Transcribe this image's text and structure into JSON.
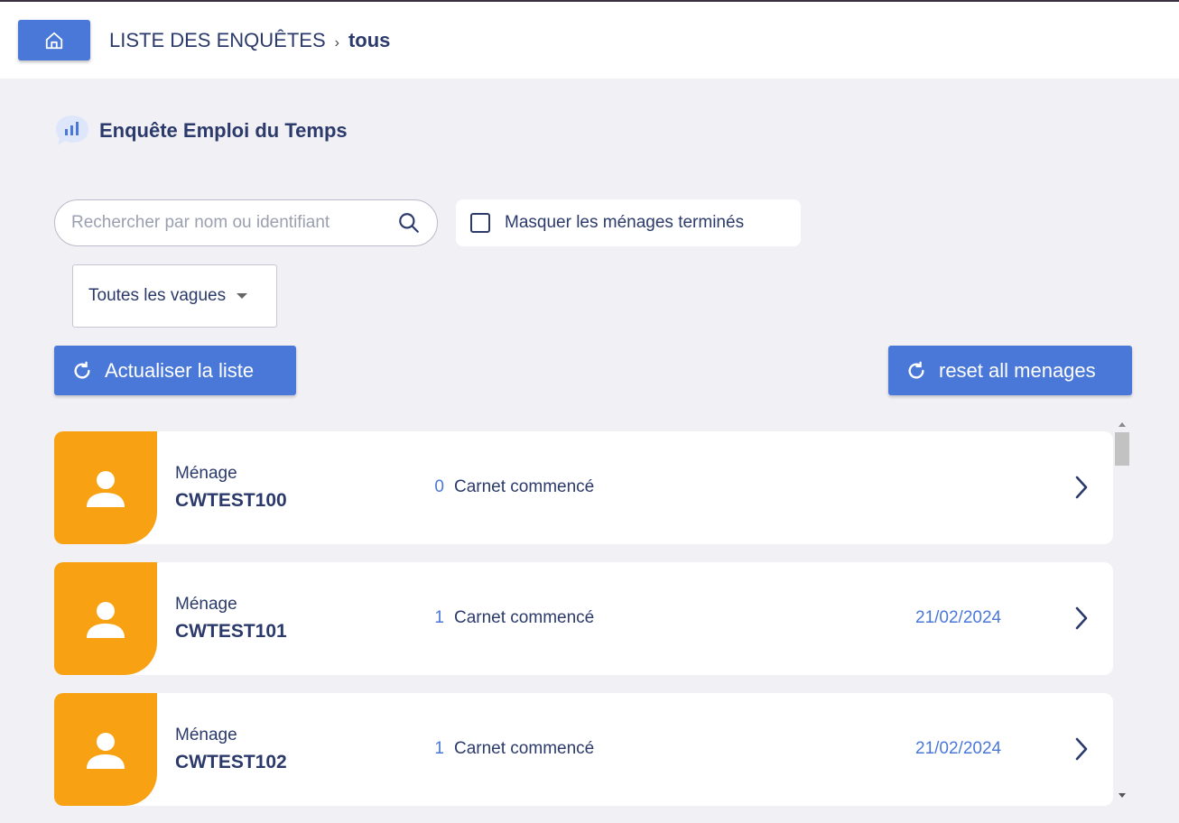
{
  "header": {
    "breadcrumb_root": "LISTE DES ENQUÊTES",
    "breadcrumb_separator": "›",
    "breadcrumb_current": "tous",
    "home_icon": "home-icon"
  },
  "survey": {
    "title": "Enquête Emploi du Temps",
    "icon": "chat-chart-icon"
  },
  "filters": {
    "search_placeholder": "Rechercher par nom ou identifiant",
    "search_value": "",
    "hide_finished_label": "Masquer les ménages terminés",
    "hide_finished_checked": false,
    "wave_select_value": "Toutes les vagues"
  },
  "actions": {
    "refresh_label": "Actualiser la liste",
    "reset_label": "reset all menages"
  },
  "households": [
    {
      "kind": "Ménage",
      "id": "CWTEST100",
      "count": "0",
      "status": "Carnet commencé",
      "date": ""
    },
    {
      "kind": "Ménage",
      "id": "CWTEST101",
      "count": "1",
      "status": "Carnet commencé",
      "date": "21/02/2024"
    },
    {
      "kind": "Ménage",
      "id": "CWTEST102",
      "count": "1",
      "status": "Carnet commencé",
      "date": "21/02/2024"
    }
  ],
  "colors": {
    "primary": "#4a78d9",
    "avatar_bg": "#f7a113",
    "text_dark": "#2b3a6b",
    "page_bg": "#f0f0f5"
  }
}
